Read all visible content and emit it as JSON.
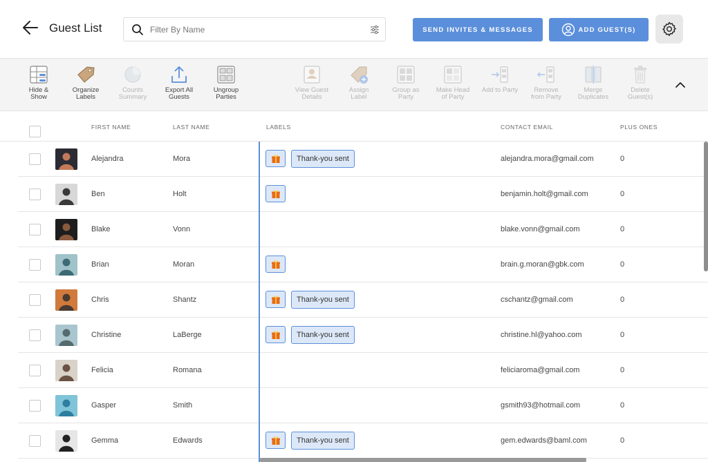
{
  "header": {
    "title": "Guest List",
    "search_placeholder": "Filter By Name",
    "send_button": "SEND INVITES & MESSAGES",
    "add_button": "ADD GUEST(S)"
  },
  "toolbar": [
    {
      "label": "Hide &\nShow",
      "icon": "hide-show-icon",
      "enabled": true
    },
    {
      "label": "Organize\nLabels",
      "icon": "tag-icon",
      "enabled": true
    },
    {
      "label": "Counts\nSummary",
      "icon": "pie-chart-icon",
      "enabled": false
    },
    {
      "label": "Export All\nGuests",
      "icon": "export-icon",
      "enabled": true
    },
    {
      "label": "Ungroup\nParties",
      "icon": "ungroup-icon",
      "enabled": true
    },
    {
      "label": "View Guest\nDetails",
      "icon": "guest-details-icon",
      "enabled": false
    },
    {
      "label": "Assign\nLabel",
      "icon": "assign-label-icon",
      "enabled": false
    },
    {
      "label": "Group as\nParty",
      "icon": "group-party-icon",
      "enabled": false
    },
    {
      "label": "Make Head\nof Party",
      "icon": "head-party-icon",
      "enabled": false
    },
    {
      "label": "Add to Party",
      "icon": "add-to-party-icon",
      "enabled": false
    },
    {
      "label": "Remove\nfrom Party",
      "icon": "remove-from-party-icon",
      "enabled": false
    },
    {
      "label": "Merge\nDuplicates",
      "icon": "merge-icon",
      "enabled": false
    },
    {
      "label": "Delete\nGuest(s)",
      "icon": "trash-icon",
      "enabled": false
    }
  ],
  "columns": {
    "first_name": "FIRST NAME",
    "last_name": "LAST NAME",
    "labels": "LABELS",
    "contact_email": "CONTACT EMAIL",
    "plus_ones": "PLUS ONES"
  },
  "label_text": "Thank-you sent",
  "guests": [
    {
      "first": "Alejandra",
      "last": "Mora",
      "email": "alejandra.mora@gmail.com",
      "plus": "0",
      "gift": true,
      "thankyou": true,
      "avatar_colors": [
        "#2b2b33",
        "#c27a5a"
      ]
    },
    {
      "first": "Ben",
      "last": "Holt",
      "email": "benjamin.holt@gmail.com",
      "plus": "0",
      "gift": true,
      "thankyou": false,
      "avatar_colors": [
        "#d8d8d8",
        "#3a3a3a"
      ]
    },
    {
      "first": "Blake",
      "last": "Vonn",
      "email": "blake.vonn@gmail.com",
      "plus": "0",
      "gift": false,
      "thankyou": false,
      "avatar_colors": [
        "#1d1d1d",
        "#8a5a3e"
      ]
    },
    {
      "first": "Brian",
      "last": "Moran",
      "email": "brain.g.moran@gbk.com",
      "plus": "0",
      "gift": true,
      "thankyou": false,
      "avatar_colors": [
        "#9fc3c9",
        "#3e6a74"
      ]
    },
    {
      "first": "Chris",
      "last": "Shantz",
      "email": "cschantz@gmail.com",
      "plus": "0",
      "gift": true,
      "thankyou": true,
      "avatar_colors": [
        "#d07a3c",
        "#4a3a30"
      ]
    },
    {
      "first": "Christine",
      "last": "LaBerge",
      "email": "christine.hl@yahoo.com",
      "plus": "0",
      "gift": true,
      "thankyou": true,
      "avatar_colors": [
        "#a9c6cf",
        "#556b6e"
      ]
    },
    {
      "first": "Felicia",
      "last": "Romana",
      "email": "feliciaroma@gmail.com",
      "plus": "0",
      "gift": false,
      "thankyou": false,
      "avatar_colors": [
        "#d9d2c9",
        "#6b5244"
      ]
    },
    {
      "first": "Gasper",
      "last": "Smith",
      "email": "gsmith93@hotmail.com",
      "plus": "0",
      "gift": false,
      "thankyou": false,
      "avatar_colors": [
        "#7fc4d8",
        "#2e7ea0"
      ]
    },
    {
      "first": "Gemma",
      "last": "Edwards",
      "email": "gem.edwards@baml.com",
      "plus": "0",
      "gift": true,
      "thankyou": true,
      "avatar_colors": [
        "#e6e6e6",
        "#222222"
      ]
    }
  ],
  "colors": {
    "accent": "#5b8fdb",
    "badge_bg": "#dce8f8",
    "gift": "#e86a1a"
  }
}
